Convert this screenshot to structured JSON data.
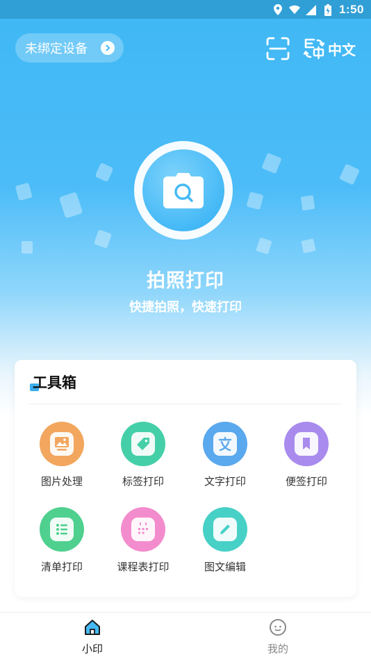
{
  "status_bar": {
    "time": "1:50",
    "battery_icon": "battery-charging-icon",
    "icons": [
      "location-icon",
      "wifi-icon",
      "signal-icon",
      "battery-charging-icon"
    ]
  },
  "header": {
    "device_label": "未绑定设备",
    "language_label": "中文",
    "scan_icon": "scan-icon",
    "translate_icon": "translate-icon"
  },
  "hero": {
    "title": "拍照打印",
    "subtitle": "快捷拍照，快速打印",
    "icon": "camera-icon"
  },
  "toolbox": {
    "title": "工具箱",
    "tools": [
      {
        "label": "图片处理",
        "icon": "image-icon",
        "color": "#f2a65e"
      },
      {
        "label": "标签打印",
        "icon": "tag-icon",
        "color": "#45cfa8"
      },
      {
        "label": "文字打印",
        "icon": "text-icon",
        "color": "#5aa8ee"
      },
      {
        "label": "便签打印",
        "icon": "bookmark-icon",
        "color": "#a98bee"
      },
      {
        "label": "清单打印",
        "icon": "list-icon",
        "color": "#4fd08f"
      },
      {
        "label": "课程表打印",
        "icon": "calendar-icon",
        "color": "#f38ccd"
      },
      {
        "label": "图文编辑",
        "icon": "edit-icon",
        "color": "#47d0c6"
      }
    ]
  },
  "tabbar": {
    "tabs": [
      {
        "label": "小印",
        "icon": "home-icon",
        "active": true
      },
      {
        "label": "我的",
        "icon": "profile-icon",
        "active": false
      }
    ],
    "active_color": "#1a1a1a",
    "inactive_color": "#888888"
  },
  "colors": {
    "primary": "#45b9f6",
    "accent": "#3aaef0"
  }
}
